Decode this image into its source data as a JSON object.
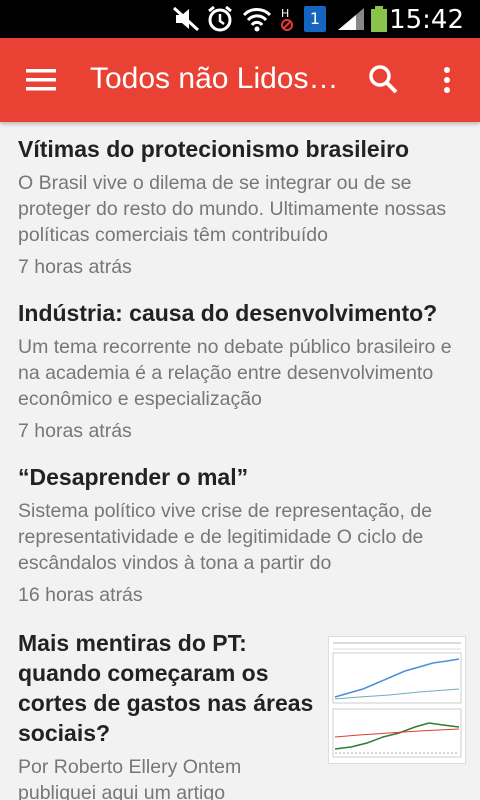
{
  "status_bar": {
    "time": "15:42",
    "battery_badge": "1"
  },
  "app_bar": {
    "title": "Todos não Lidos…"
  },
  "articles": [
    {
      "headline": "Vítimas do protecionismo brasileiro",
      "snippet": "O Brasil vive o dilema de se integrar ou de se proteger do resto do mundo. Ultimamente nossas políticas comerciais têm contribuído",
      "time": "7 horas atrás"
    },
    {
      "headline": "Indústria: causa do desenvolvimento?",
      "snippet": "Um tema recorrente no debate público brasileiro e na academia é a relação entre desenvolvimento econômico e especialização",
      "time": "7 horas atrás"
    },
    {
      "headline": "“Desaprender o mal”",
      "snippet": "Sistema político vive crise de representação, de representatividade e de legitimidade O ciclo de escândalos vindos à tona a partir do",
      "time": "16 horas atrás"
    },
    {
      "headline": "Mais mentiras do PT: quando começaram os cortes de gastos nas áreas sociais?",
      "snippet": "Por Roberto Ellery Ontem publiquei aqui um artigo",
      "time": ""
    }
  ],
  "colors": {
    "app_bar": "#e94235",
    "background": "#f2f2f2"
  }
}
